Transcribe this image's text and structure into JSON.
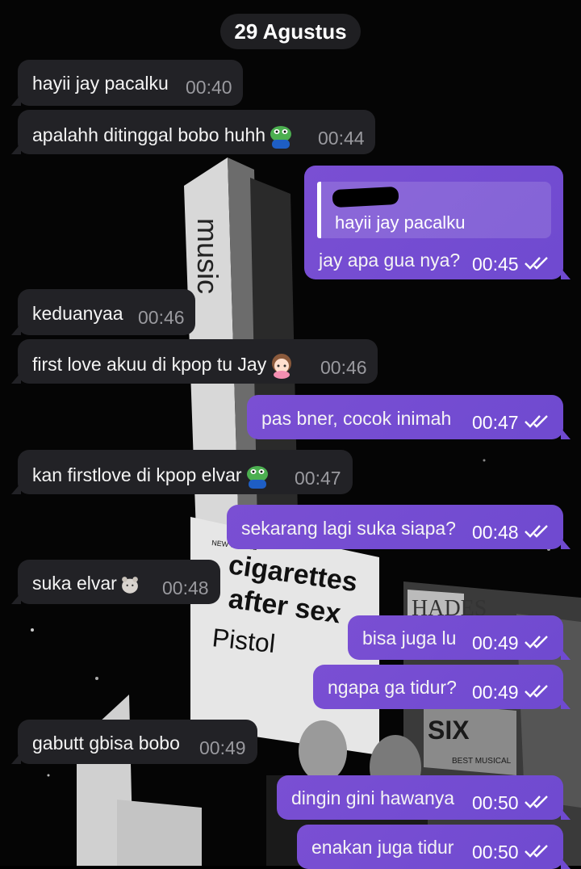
{
  "chat": {
    "date_label": "29 Agustus",
    "messages": [
      {
        "dir": "in",
        "text": "hayii jay pacalku",
        "time": "00:40"
      },
      {
        "dir": "in",
        "text": "apalahh ditinggal bobo huhh",
        "time": "00:44",
        "emoji": "frog-sticker"
      },
      {
        "dir": "out",
        "text": "jay apa gua nya?",
        "time": "00:45",
        "reply_to": {
          "sender": "",
          "text": "hayii jay pacalku"
        }
      },
      {
        "dir": "in",
        "text": "keduanyaa",
        "time": "00:46"
      },
      {
        "dir": "in",
        "text": "first love akuu di kpop tu Jay",
        "time": "00:46",
        "emoji": "anime-girl-sticker"
      },
      {
        "dir": "out",
        "text": "pas bner, cocok inimah",
        "time": "00:47"
      },
      {
        "dir": "in",
        "text": "kan firstlove di kpop elvar",
        "time": "00:47",
        "emoji": "frog-sticker"
      },
      {
        "dir": "out",
        "text": "sekarang lagi suka siapa?",
        "time": "00:48"
      },
      {
        "dir": "in",
        "text": "suka elvar",
        "time": "00:48",
        "emoji": "hamster-sticker"
      },
      {
        "dir": "out",
        "text": "bisa juga lu",
        "time": "00:49"
      },
      {
        "dir": "out",
        "text": "ngapa ga tidur?",
        "time": "00:49"
      },
      {
        "dir": "in",
        "text": "gabutt gbisa bobo",
        "time": "00:49"
      },
      {
        "dir": "out",
        "text": "dingin gini hawanya",
        "time": "00:50"
      },
      {
        "dir": "out",
        "text": "enakan juga tidur",
        "time": "00:50"
      }
    ]
  },
  "wallpaper": {
    "billboard_texts": [
      "NEW SINGLE",
      "cigarettes",
      "after sex",
      "Pistol",
      "HADES",
      "SIX",
      "music",
      "BEST MUSICAL"
    ]
  },
  "colors": {
    "incoming_bubble": "#222226",
    "outgoing_bubble": "#6f4ad0",
    "date_pill": "#1f1f22",
    "background": "#000000"
  }
}
